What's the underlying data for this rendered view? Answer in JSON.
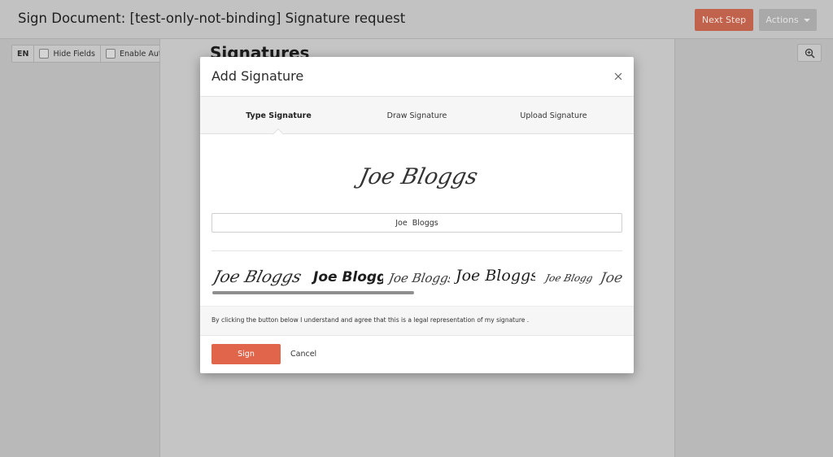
{
  "header": {
    "title": "Sign Document: [test-only-not-binding] Signature request",
    "next_step_label": "Next Step",
    "actions_label": "Actions"
  },
  "toolbar": {
    "language": "EN",
    "hide_fields_label": "Hide Fields",
    "hide_fields_checked": false,
    "autoscroll_label": "Enable Autoscroll",
    "autoscroll_checked": false,
    "zoom_icon": "zoom-in-icon"
  },
  "document": {
    "heading": "Signatures"
  },
  "modal": {
    "title": "Add Signature",
    "close_icon": "close-icon",
    "tabs": [
      {
        "label": "Type Signature",
        "active": true
      },
      {
        "label": "Draw Signature",
        "active": false
      },
      {
        "label": "Upload Signature",
        "active": false
      }
    ],
    "preview_signature": "Joe Bloggs",
    "name_value": "Joe  Bloggs",
    "style_options": [
      "Joe  Bloggs",
      "Joe Bloggs",
      "Joe Bloggs",
      "Joe  Bloggs",
      "Joe Bloggs",
      "Joe"
    ],
    "legal_note": "By clicking the button below I understand and agree that this is a legal representation of my signature .",
    "sign_label": "Sign",
    "cancel_label": "Cancel"
  },
  "colors": {
    "accent": "#e0654b",
    "overlay": "#b9b9b9"
  }
}
